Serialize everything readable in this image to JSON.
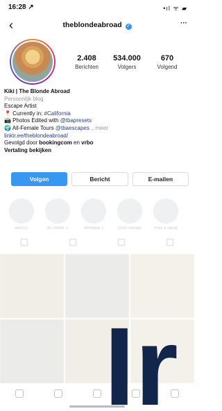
{
  "status": {
    "time": "16:28 ↗",
    "system": "•ıl ᯤ ▰"
  },
  "profile": {
    "username": "theblondeabroad",
    "verified_glyph": "✓",
    "more_glyph": "···",
    "back_glyph": "‹"
  },
  "stats": [
    {
      "value": "2.408",
      "label": "Berichten"
    },
    {
      "value": "534.000",
      "label": "Volgers"
    },
    {
      "value": "670",
      "label": "Volgend"
    }
  ],
  "bio": {
    "name": "Kiki | The Blonde Abroad",
    "category": "Persoonlijk blog",
    "line1": "Escape Artist",
    "line2_prefix": "📍 Currently in: ",
    "line2_tag": "#California",
    "line3_prefix": "📸 Photos Edited with ",
    "line3_tag": "@tbapresets",
    "line4_prefix": "🌍 All-Female Tours ",
    "line4_tag": "@tbaescapes",
    "line4_more": "... meer",
    "link": "linktr.ee/theblondeabroad/",
    "followed_prefix": "Gevolgd door ",
    "followed_a": "bookingcom",
    "followed_mid": " en ",
    "followed_b": "vrbo",
    "translate": "Vertaling bekijken"
  },
  "actions": {
    "follow": "Volgen",
    "message": "Bericht",
    "email": "E-mailen"
  },
  "highlights": [
    "Best15",
    "3D Home Ti",
    "Renewal 1",
    "5000 Recipe",
    "Post a Vacat"
  ],
  "watermark": "Ir",
  "colors": {
    "accent": "#3897f0",
    "watermark": "#12254a"
  }
}
